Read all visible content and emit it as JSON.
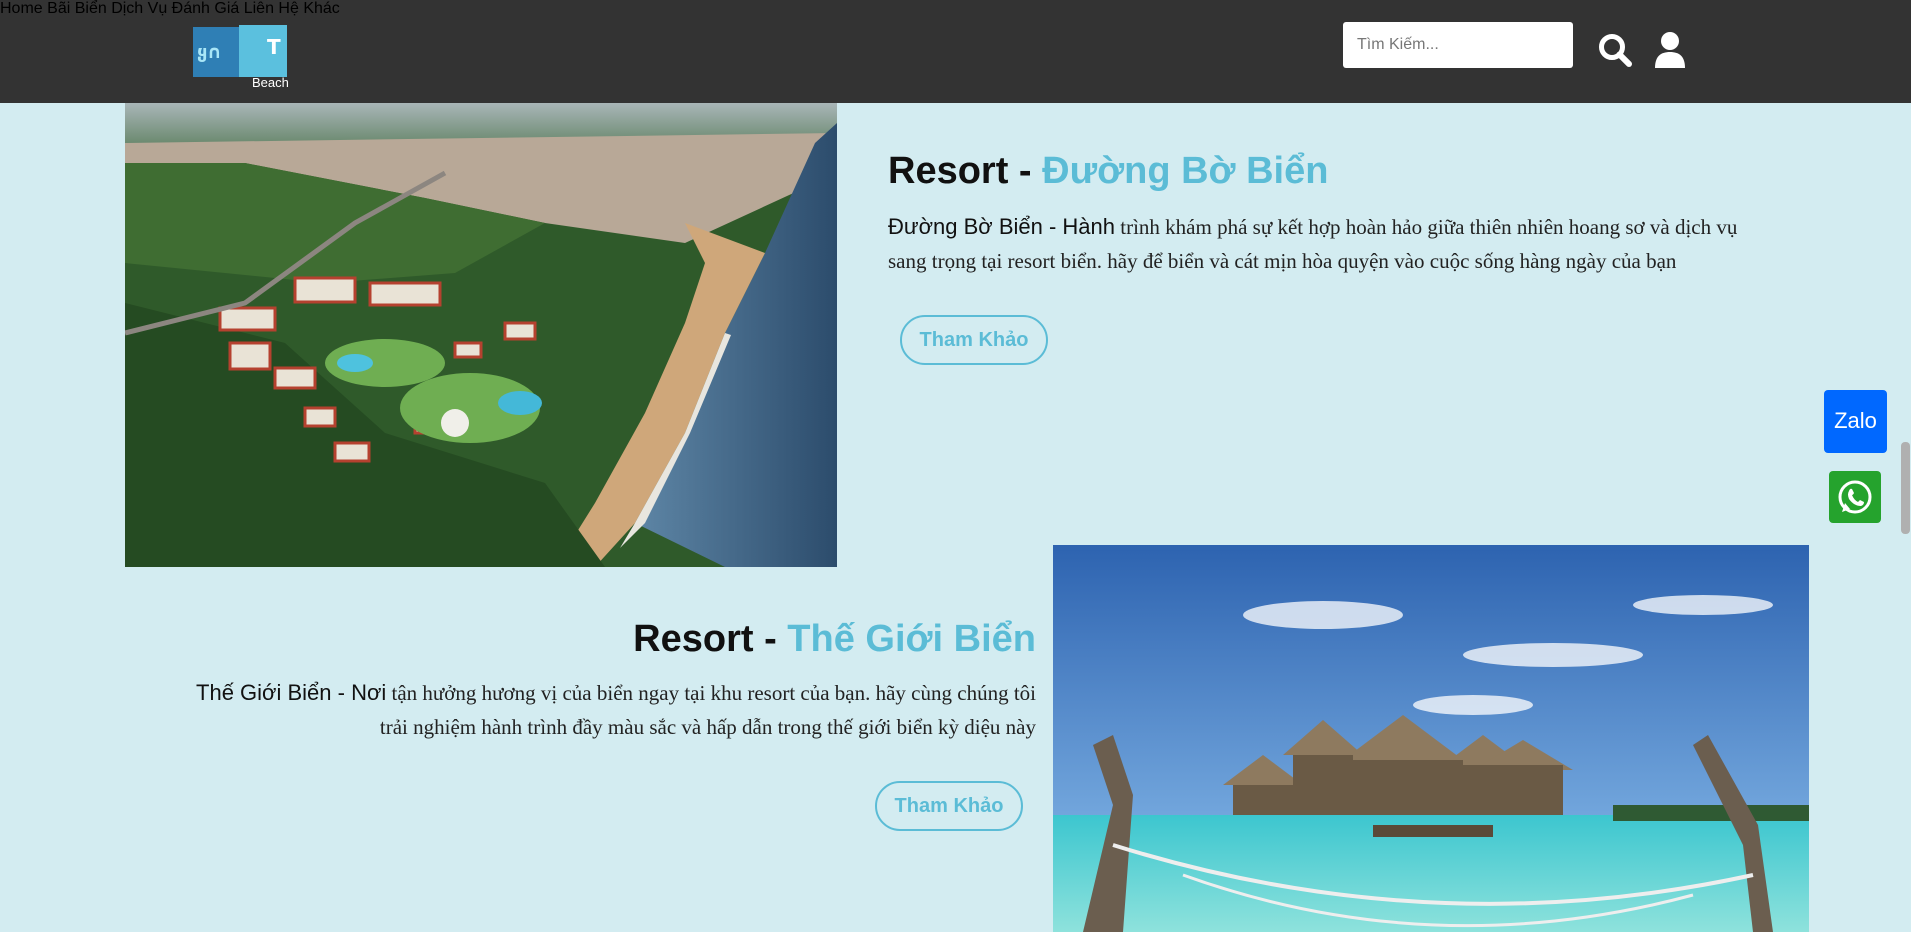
{
  "header": {
    "logo": {
      "left_text": "ყ∩",
      "right_text": "T",
      "sub": "Beach"
    },
    "nav": [
      "Home",
      "Bãi Biển",
      "Dịch Vụ",
      "Đánh Giá",
      "Liên Hệ",
      "Khác"
    ],
    "search_placeholder": "Tìm Kiếm..."
  },
  "sections": [
    {
      "title_prefix": "Resort - ",
      "title_accent": "Đường Bờ Biển",
      "desc_lead": "Đường Bờ Biển - Hành",
      "desc_rest": " trình khám phá sự kết hợp hoàn hảo giữa thiên nhiên hoang sơ và dịch vụ sang trọng tại resort biển. hãy để biển và cát mịn hòa quyện vào cuộc sống hàng ngày của bạn",
      "button": "Tham Khảo"
    },
    {
      "title_prefix": "Resort - ",
      "title_accent": "Thế Giới Biển",
      "desc_lead": "Thế Giới Biển - Nơi",
      "desc_rest": " tận hưởng hương vị của biển ngay tại khu resort của bạn. hãy cùng chúng tôi trải nghiệm hành trình đầy màu sắc và hấp dẫn trong thế giới biển kỳ diệu này",
      "button": "Tham Khảo"
    }
  ],
  "floating": {
    "zalo_label": "Zalo"
  },
  "colors": {
    "header_bg": "#333333",
    "page_bg": "#d3ecf1",
    "accent": "#5bbcd6"
  },
  "icons": [
    "search-icon",
    "user-icon",
    "zalo-icon",
    "whatsapp-icon"
  ]
}
